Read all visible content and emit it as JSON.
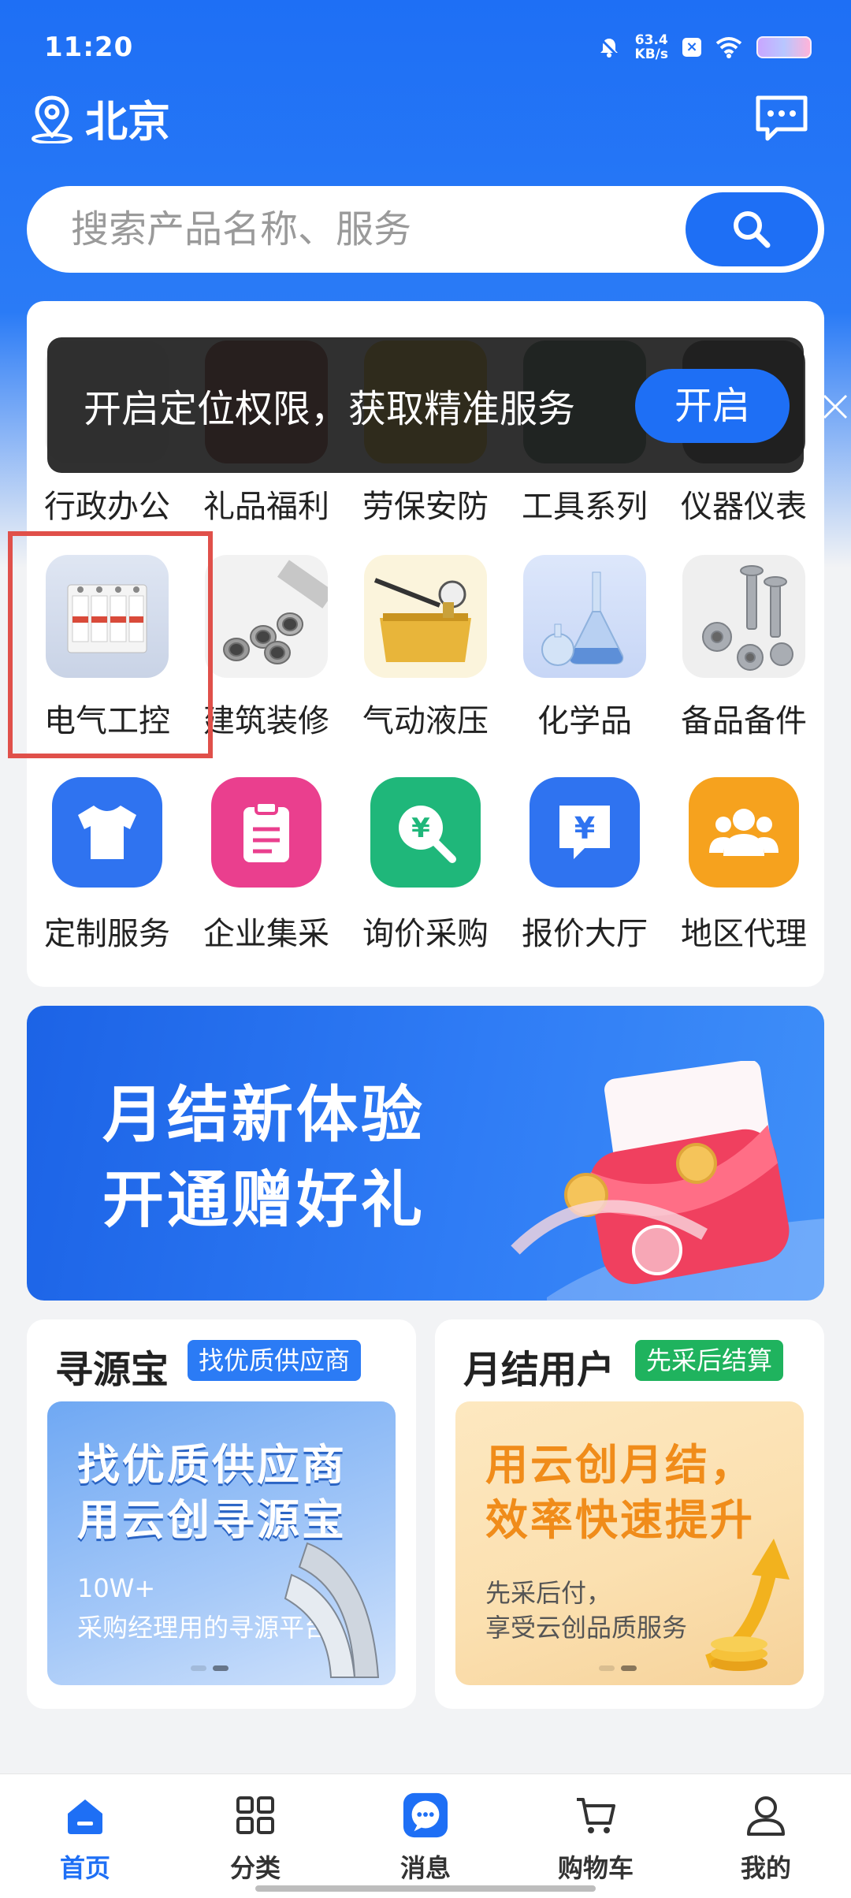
{
  "status": {
    "time": "11:20",
    "speed_value": "63.4",
    "speed_unit": "KB/s"
  },
  "header": {
    "city": "北京"
  },
  "search": {
    "placeholder": "搜索产品名称、服务"
  },
  "categories_row1": [
    {
      "label": "行政办公"
    },
    {
      "label": "礼品福利"
    },
    {
      "label": "劳保安防"
    },
    {
      "label": "工具系列"
    },
    {
      "label": "仪器仪表"
    }
  ],
  "categories_row2": [
    {
      "label": "电气工控"
    },
    {
      "label": "建筑装修"
    },
    {
      "label": "气动液压"
    },
    {
      "label": "化学品"
    },
    {
      "label": "备品备件"
    }
  ],
  "services": [
    {
      "label": "定制服务",
      "icon": "shirt-icon",
      "color": "#2f73f0"
    },
    {
      "label": "企业集采",
      "icon": "clipboard-icon",
      "color": "#ea3f8e"
    },
    {
      "label": "询价采购",
      "icon": "yen-search-icon",
      "color": "#1fb77a"
    },
    {
      "label": "报价大厅",
      "icon": "yen-chat-icon",
      "color": "#2f73f0"
    },
    {
      "label": "地区代理",
      "icon": "people-icon",
      "color": "#f6a21e"
    }
  ],
  "toast": {
    "text": "开启定位权限，获取精准服务",
    "button": "开启"
  },
  "banner": {
    "line1": "月结新体验",
    "line2": "开通赠好礼"
  },
  "card_left": {
    "title": "寻源宝",
    "tag": "找优质供应商",
    "headline1": "找优质供应商",
    "headline2": "用云创寻源宝",
    "sub1": "10W+",
    "sub2": "采购经理用的寻源平台"
  },
  "card_right": {
    "title": "月结用户",
    "tag": "先采后结算",
    "headline1": "用云创月结，",
    "headline2": "效率快速提升",
    "sub1": "先采后付，",
    "sub2": "享受云创品质服务"
  },
  "nav": [
    {
      "label": "首页",
      "icon": "home-icon",
      "active": true
    },
    {
      "label": "分类",
      "icon": "grid-icon",
      "active": false
    },
    {
      "label": "消息",
      "icon": "message-icon",
      "active": false
    },
    {
      "label": "购物车",
      "icon": "cart-icon",
      "active": false
    },
    {
      "label": "我的",
      "icon": "user-icon",
      "active": false
    }
  ],
  "colors": {
    "primary": "#1e6ff5",
    "highlight": "#e0504a",
    "tag_blue": "#2b7bf5",
    "tag_green": "#1fb35e"
  }
}
